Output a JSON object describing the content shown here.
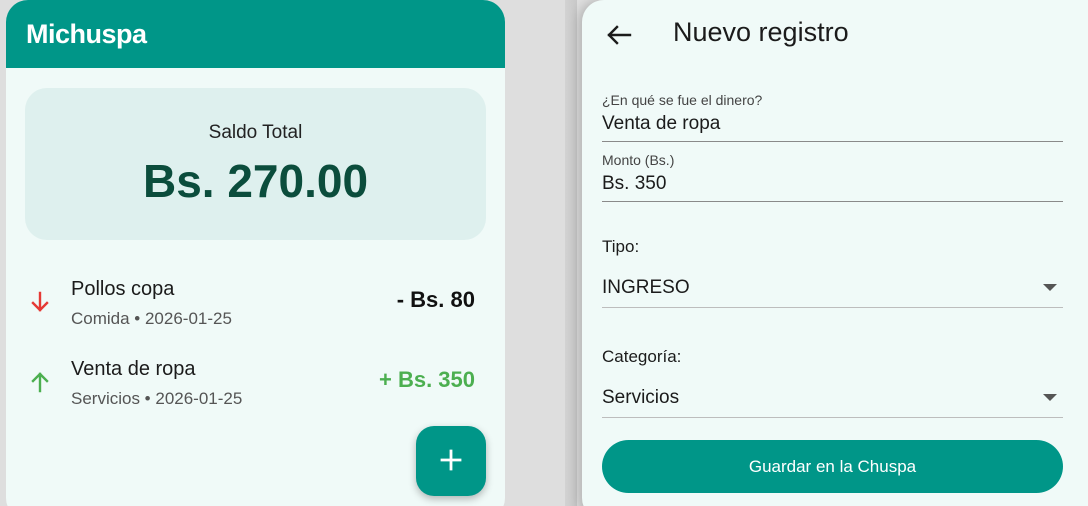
{
  "home": {
    "app_title": "Michuspa",
    "balance": {
      "label": "Saldo Total",
      "value": "Bs. 270.00"
    },
    "transactions": [
      {
        "title": "Pollos copa",
        "subtitle": "Comida • 2026-01-25",
        "amount": "- Bs. 80",
        "direction": "down",
        "icon": "arrow-down-icon",
        "color": "#e53935"
      },
      {
        "title": "Venta de ropa",
        "subtitle": "Servicios • 2026-01-25",
        "amount": "+ Bs. 350",
        "direction": "up",
        "icon": "arrow-up-icon",
        "color": "#4caf50"
      }
    ],
    "fab_icon": "plus-icon"
  },
  "form": {
    "title": "Nuevo registro",
    "back_icon": "arrow-left-icon",
    "description": {
      "label": "¿En qué se fue el dinero?",
      "value": "Venta de ropa"
    },
    "amount": {
      "label": "Monto (Bs.)",
      "value": "Bs. 350"
    },
    "type": {
      "label": "Tipo:",
      "selected": "INGRESO"
    },
    "category": {
      "label": "Categoría:",
      "selected": "Servicios"
    },
    "save_label": "Guardar en la Chuspa"
  },
  "colors": {
    "primary": "#009688",
    "background": "#f0faf8",
    "card": "#def0ee",
    "balance_text": "#0b4d3c",
    "expense": "#e53935",
    "income": "#4caf50"
  }
}
